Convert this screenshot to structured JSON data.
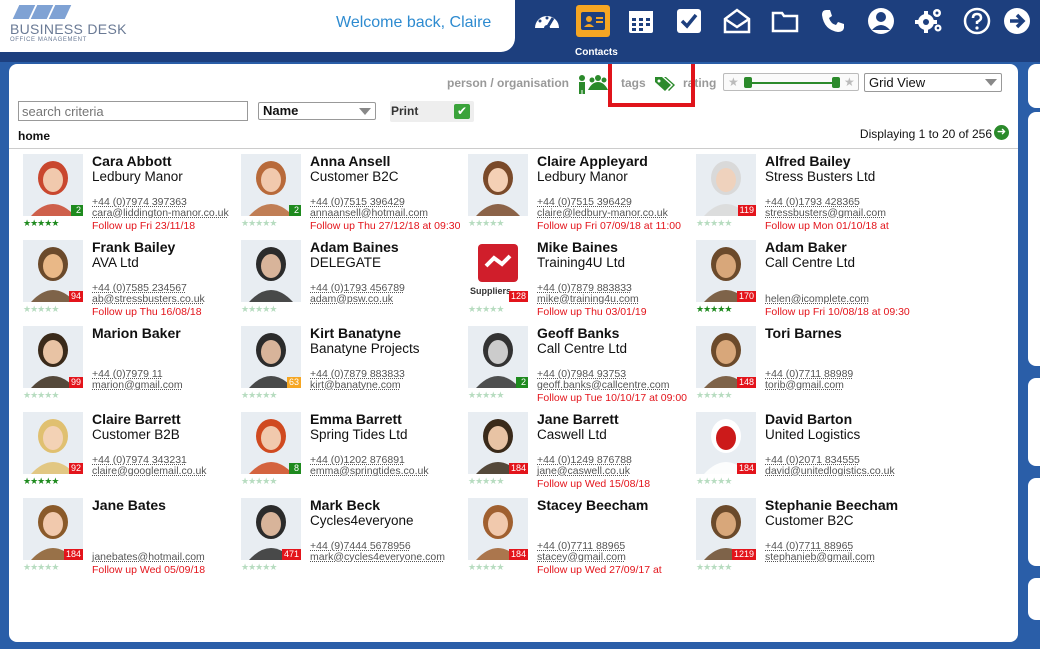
{
  "app": {
    "brand_name": "BUSINESS DESK",
    "brand_sub": "OFFICE MANAGEMENT",
    "welcome": "Welcome back, Claire",
    "active_nav_label": "Contacts"
  },
  "nav": [
    {
      "icon": "dashboard-icon"
    },
    {
      "icon": "contacts-icon"
    },
    {
      "icon": "calendar-icon"
    },
    {
      "icon": "tasks-icon"
    },
    {
      "icon": "mail-icon"
    },
    {
      "icon": "folder-icon"
    },
    {
      "icon": "phone-icon"
    },
    {
      "icon": "user-icon"
    },
    {
      "icon": "settings-icon"
    },
    {
      "icon": "help-icon"
    },
    {
      "icon": "logout-icon"
    }
  ],
  "filters": {
    "person_org_label": "person / organisation",
    "tags_label": "tags",
    "rating_label": "rating",
    "view_value": "Grid View",
    "search_placeholder": "search criteria",
    "sort_value": "Name",
    "print_label": "Print",
    "print_checked": true,
    "breadcrumb": "home",
    "displaying": "Displaying 1 to 20 of 256"
  },
  "colors": {
    "header": "#1d3f7e",
    "background": "#2a5ea8",
    "accent_orange": "#f5a623",
    "link_blue": "#2e8bd0",
    "highlight_red": "#e0141b",
    "star_green": "#1e8a1e"
  },
  "contacts": [
    {
      "name": "Cara Abbott",
      "org": "Ledbury Manor",
      "phone": "+44 (0)7974 397363",
      "email": "cara@liddington-manor.co.uk",
      "follow": "Follow up Fri 23/11/18",
      "badge": "2",
      "badge_color": "green",
      "stars": 5
    },
    {
      "name": "Anna Ansell",
      "org": "Customer B2C",
      "phone": "+44 (0)7515 396429",
      "email": "annaansell@hotmail.com",
      "follow": "Follow up Thu 27/12/18 at 09:30",
      "badge": "2",
      "badge_color": "green",
      "stars": 0
    },
    {
      "name": "Claire Appleyard",
      "org": "Ledbury Manor",
      "phone": "+44 (0)7515 396429",
      "email": "claire@ledbury-manor.co.uk",
      "follow": "Follow up Fri 07/09/18 at 11:00",
      "badge": "",
      "badge_color": "",
      "stars": 0
    },
    {
      "name": "Alfred Bailey",
      "org": "Stress Busters Ltd",
      "phone": "+44 (0)1793 428365",
      "email": "stressbusters@gmail.com",
      "follow": "Follow up Mon 01/10/18 at",
      "badge": "119",
      "badge_color": "red",
      "stars": 0
    },
    {
      "name": "Frank Bailey",
      "org": "AVA Ltd",
      "phone": "+44 (0)7585 234567",
      "email": "ab@stressbusters.co.uk",
      "follow": "Follow up Thu 16/08/18",
      "badge": "94",
      "badge_color": "red",
      "stars": 0
    },
    {
      "name": "Adam Baines",
      "org": "DELEGATE",
      "phone": "+44 (0)1793 456789",
      "email": "adam@psw.co.uk",
      "follow": "",
      "badge": "",
      "badge_color": "",
      "stars": 0
    },
    {
      "name": "Mike Baines",
      "org": "Training4U Ltd",
      "phone": "+44 (0)7879 883833",
      "email": "mike@training4u.com",
      "follow": "Follow up Thu 03/01/19",
      "badge": "128",
      "badge_color": "red",
      "stars": 0,
      "photo_caption": "Suppliers"
    },
    {
      "name": "Adam Baker",
      "org": "Call Centre Ltd",
      "phone": "",
      "email": "helen@icomplete.com",
      "follow": "Follow up Fri 10/08/18 at 09:30",
      "badge": "170",
      "badge_color": "red",
      "stars": 5
    },
    {
      "name": "Marion Baker",
      "org": "",
      "phone": "+44 (0)7979 11",
      "email": "marion@gmail.com",
      "follow": "",
      "badge": "99",
      "badge_color": "red",
      "stars": 0
    },
    {
      "name": "Kirt Banatyne",
      "org": "Banatyne Projects",
      "phone": "+44 (0)7879 883833",
      "email": "kirt@banatyne.com",
      "follow": "",
      "badge": "63",
      "badge_color": "amber",
      "stars": 0
    },
    {
      "name": "Geoff Banks",
      "org": "Call Centre Ltd",
      "phone": "+44 (0)7984 93753",
      "email": "geoff.banks@callcentre.com",
      "follow": "Follow up Tue 10/10/17 at 09:00",
      "badge": "2",
      "badge_color": "green",
      "stars": 0
    },
    {
      "name": "Tori Barnes",
      "org": "",
      "phone": "+44 (0)7711 88989",
      "email": "torib@gmail.com",
      "follow": "",
      "badge": "148",
      "badge_color": "red",
      "stars": 0
    },
    {
      "name": "Claire Barrett",
      "org": "Customer B2B",
      "phone": "+44 (0)7974 343231",
      "email": "claire@googlemail.co.uk",
      "follow": "",
      "badge": "92",
      "badge_color": "red",
      "stars": 5
    },
    {
      "name": "Emma Barrett",
      "org": "Spring Tides Ltd",
      "phone": "+44 (0)1202 876891",
      "email": "emma@springtides.co.uk",
      "follow": "",
      "badge": "8",
      "badge_color": "green",
      "stars": 0
    },
    {
      "name": "Jane Barrett",
      "org": "Caswell Ltd",
      "phone": "+44 (0)1249 876788",
      "email": "jane@caswell.co.uk",
      "follow": "Follow up Wed 15/08/18",
      "badge": "184",
      "badge_color": "red",
      "stars": 0
    },
    {
      "name": "David Barton",
      "org": "United Logistics",
      "phone": "+44 (0)2071 834555",
      "email": "david@unitedlogistics.co.uk",
      "follow": "",
      "badge": "184",
      "badge_color": "red",
      "stars": 0
    },
    {
      "name": "Jane Bates",
      "org": "",
      "phone": "",
      "email": "janebates@hotmail.com",
      "follow": "Follow up Wed 05/09/18",
      "badge": "184",
      "badge_color": "red",
      "stars": 0
    },
    {
      "name": "Mark Beck",
      "org": "Cycles4everyone",
      "phone": "+44 (9)7444 5678956",
      "email": "mark@cycles4everyone.com",
      "follow": "",
      "badge": "471",
      "badge_color": "red",
      "stars": 0
    },
    {
      "name": "Stacey Beecham",
      "org": "",
      "phone": "+44 (0)7711 88965",
      "email": "stacey@gmail.com",
      "follow": "Follow up Wed 27/09/17 at",
      "badge": "184",
      "badge_color": "red",
      "stars": 0
    },
    {
      "name": "Stephanie Beecham",
      "org": "Customer B2C",
      "phone": "+44 (0)7711 88965",
      "email": "stephanieb@gmail.com",
      "follow": "",
      "badge": "1219",
      "badge_color": "red",
      "stars": 0
    }
  ]
}
